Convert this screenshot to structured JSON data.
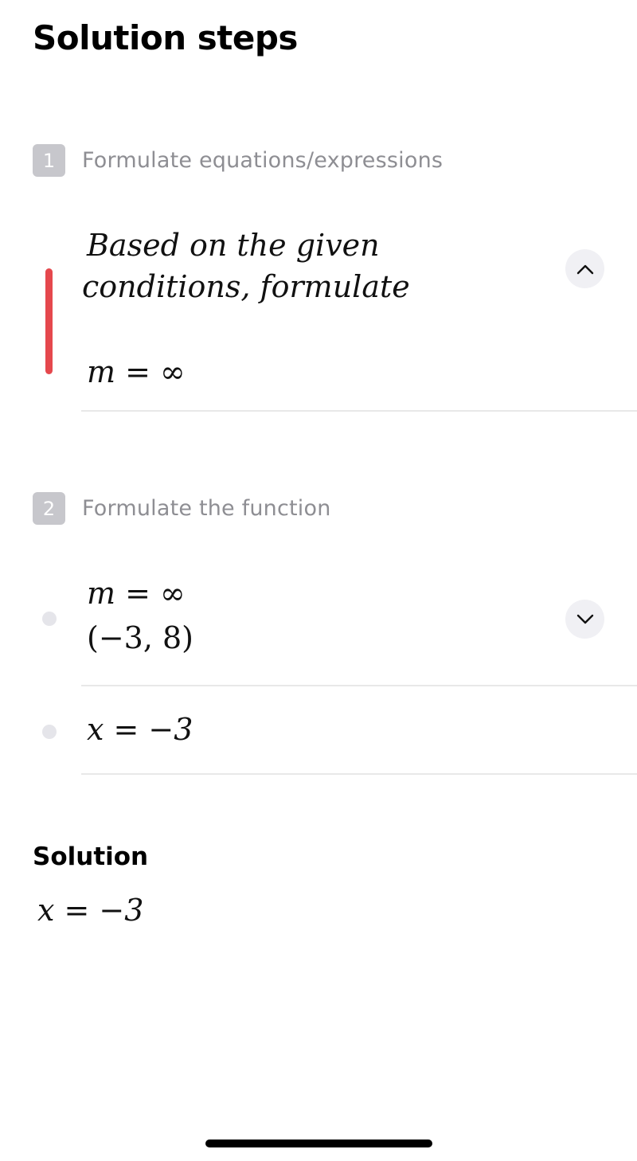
{
  "page": {
    "title": "Solution steps"
  },
  "steps": [
    {
      "number": "1",
      "title": "Formulate equations/expressions",
      "expanded": true,
      "toggle_icon": "chevron-up-icon",
      "content": {
        "description_line1": "Based on the given",
        "description_line2": "conditions, formulate",
        "equation": "m = ∞"
      }
    },
    {
      "number": "2",
      "title": "Formulate the function",
      "expanded": false,
      "toggle_icon": "chevron-down-icon",
      "items": [
        {
          "line1": "m = ∞",
          "line2": "(−3, 8)"
        },
        {
          "line1": "x = −3"
        }
      ]
    }
  ],
  "solution": {
    "label": "Solution",
    "answer": "x = −3"
  },
  "colors": {
    "active_step_bar": "#e5484d",
    "step_badge": "#c7c7cc",
    "step_title": "#8e8e93",
    "toggle_bg": "#f0f0f4",
    "bullet_dot": "#e5e5ea"
  }
}
